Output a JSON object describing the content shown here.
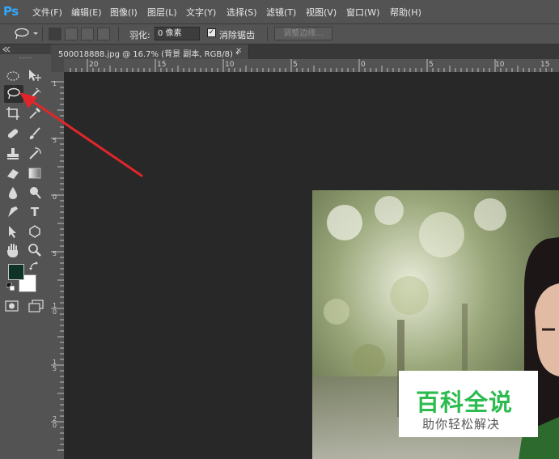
{
  "app": {
    "logo_text": "Ps"
  },
  "menu": {
    "items": [
      "文件(F)",
      "编辑(E)",
      "图像(I)",
      "图层(L)",
      "文字(Y)",
      "选择(S)",
      "滤镜(T)",
      "视图(V)",
      "窗口(W)",
      "帮助(H)"
    ]
  },
  "options": {
    "feather_label": "羽化:",
    "feather_value": "0 像素",
    "antialias_checked": true,
    "antialias_check_glyph": "✓",
    "antialias_label": "消除锯齿",
    "refine_edge_label": "调整边缘..."
  },
  "document": {
    "tab_label": "500018888.jpg @ 16.7% (背景 副本, RGB/8) *",
    "close_glyph": "×"
  },
  "rulers": {
    "horizontal_labels": [
      "20",
      "15",
      "10",
      "5",
      "0",
      "5",
      "10",
      "15"
    ],
    "vertical_labels": [
      "1",
      "5",
      "0",
      "5",
      "1 0",
      "1 5",
      "2 0"
    ]
  },
  "colors": {
    "foreground": "#0f3324",
    "background": "#ffffff",
    "accent_arrow": "#e0262a"
  },
  "watermark": {
    "title": "百科全说",
    "subtitle": "助你轻松解决"
  }
}
